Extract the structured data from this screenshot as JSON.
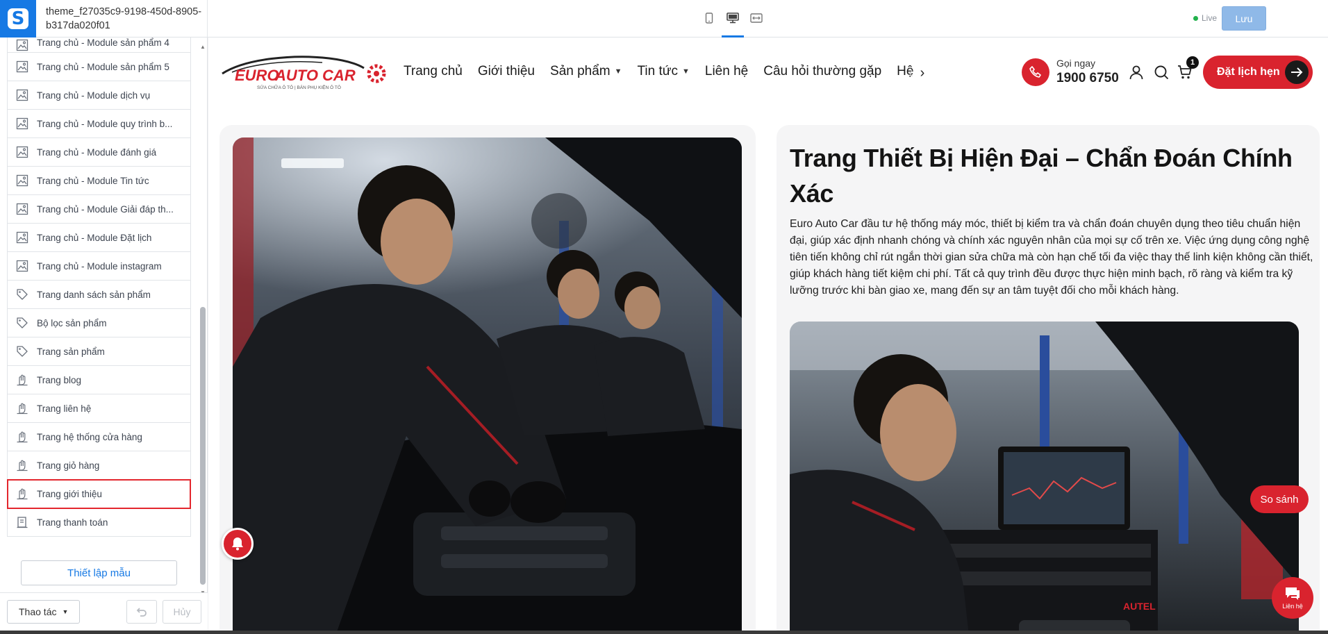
{
  "app": {
    "theme_name": "theme_f27035c9-9198-450d-8905-b317da020f01",
    "live_label": "Live",
    "save_label": "Lưu"
  },
  "sidebar": {
    "items": [
      {
        "label": "Trang chủ - Module sản phẩm 4",
        "icon": "layout-icon"
      },
      {
        "label": "Trang chủ - Module sản phẩm 5",
        "icon": "layout-icon"
      },
      {
        "label": "Trang chủ - Module dịch vụ",
        "icon": "layout-icon"
      },
      {
        "label": "Trang chủ - Module quy trình b...",
        "icon": "layout-icon"
      },
      {
        "label": "Trang chủ - Module đánh giá",
        "icon": "layout-icon"
      },
      {
        "label": "Trang chủ - Module Tin tức",
        "icon": "layout-icon"
      },
      {
        "label": "Trang chủ - Module Giải đáp th...",
        "icon": "layout-icon"
      },
      {
        "label": "Trang chủ - Module Đặt lịch",
        "icon": "layout-icon"
      },
      {
        "label": "Trang chủ - Module instagram",
        "icon": "layout-icon"
      },
      {
        "label": "Trang danh sách sản phẩm",
        "icon": "tag-icon"
      },
      {
        "label": "Bộ lọc sản phẩm",
        "icon": "tag-icon"
      },
      {
        "label": "Trang sản phẩm",
        "icon": "tag-icon"
      },
      {
        "label": "Trang blog",
        "icon": "hand-icon"
      },
      {
        "label": "Trang liên hệ",
        "icon": "hand-icon"
      },
      {
        "label": "Trang hệ thống cửa hàng",
        "icon": "hand-icon"
      },
      {
        "label": "Trang giỏ hàng",
        "icon": "hand-icon"
      },
      {
        "label": "Trang giới thiệu",
        "icon": "hand-icon",
        "selected": true
      },
      {
        "label": "Trang thanh toán",
        "icon": "pages-icon"
      }
    ],
    "setup_label": "Thiết lập mẫu",
    "actions_label": "Thao tác",
    "cancel_label": "Hủy"
  },
  "site": {
    "brand": {
      "name_part1": "EURO",
      "name_part2": "AUTO CAR",
      "tagline": "SỬA CHỮA Ô TÔ  |  BÁN PHỤ KIỆN Ô TÔ"
    },
    "nav": [
      {
        "label": "Trang chủ",
        "caret": false
      },
      {
        "label": "Giới thiệu",
        "caret": false
      },
      {
        "label": "Sản phẩm",
        "caret": true
      },
      {
        "label": "Tin tức",
        "caret": true
      },
      {
        "label": "Liên hệ",
        "caret": false
      },
      {
        "label": "Câu hỏi thường gặp",
        "caret": false
      },
      {
        "label": "Hệ",
        "caret": false
      }
    ],
    "phone_caption": "Gọi ngay",
    "phone_number": "1900 6750",
    "cart_count": "1",
    "book_label": "Đặt lịch hẹn",
    "headline": "Trang Thiết Bị Hiện Đại – Chẩn Đoán Chính Xác",
    "body": "Euro Auto Car đầu tư hệ thống máy móc, thiết bị kiểm tra và chẩn đoán chuyên dụng theo tiêu chuẩn hiện đại, giúp xác định nhanh chóng và chính xác nguyên nhân của mọi sự cố trên xe. Việc ứng dụng công nghệ tiên tiến không chỉ rút ngắn thời gian sửa chữa mà còn hạn chế tối đa việc thay thế linh kiện không cần thiết, giúp khách hàng tiết kiệm chi phí. Tất cả quy trình đều được thực hiện minh bạch, rõ ràng và kiểm tra kỹ lưỡng trước khi bàn giao xe, mang đến sự an tâm tuyệt đối cho mỗi khách hàng.",
    "compare_label": "So sánh",
    "contact_label": "Liên hệ",
    "machine_brand": "AUTEL"
  },
  "colors": {
    "brand_red": "#d9232e",
    "editor_blue": "#1679e4",
    "selection_red": "#e3262d"
  }
}
